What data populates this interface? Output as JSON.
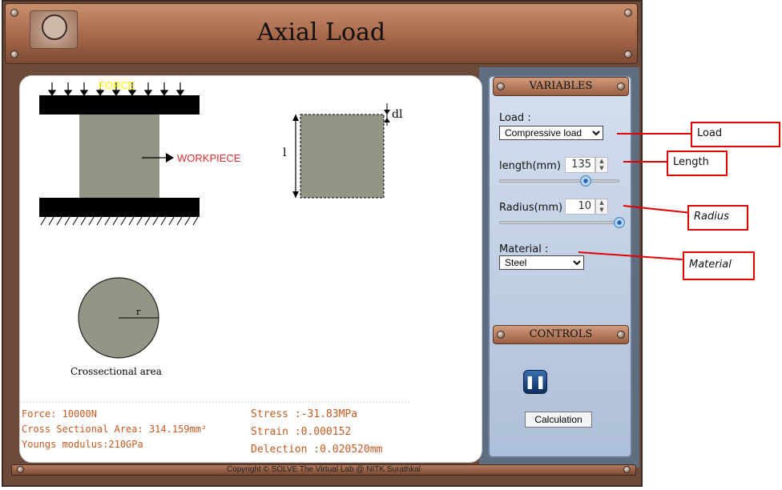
{
  "app": {
    "title": "Axial Load",
    "footer": "Copyright © SOLVE The Virtual Lab @ NITK Surathkal"
  },
  "diagram": {
    "force_label": "FORCE",
    "workpiece_label": "WORKPIECE",
    "length_symbol": "l",
    "delta_symbol": "dl",
    "radius_symbol": "r",
    "cross_section_label": "Crossectional area"
  },
  "results": {
    "force": "Force: 10000N",
    "area": "Cross Sectional Area: 314.159mm²",
    "youngs": "Youngs modulus:210GPa",
    "stress": "Stress :-31.83MPa",
    "strain": "Strain :0.000152",
    "deflection": "Delection :0.020520mm"
  },
  "variables": {
    "header": "VARIABLES",
    "load_label": "Load :",
    "load_selected": "Compressive load",
    "length_label": "length(mm)",
    "length_value": "135",
    "length_slider_fraction": 0.72,
    "radius_label": "Radius(mm)",
    "radius_value": "10",
    "radius_slider_fraction": 1.0,
    "material_label": "Material :",
    "material_selected": "Steel"
  },
  "controls": {
    "header": "CONTROLS",
    "calc_label": "Calculation"
  },
  "callouts": {
    "load": "Load",
    "length": "Length",
    "radius": "Radius",
    "material": "Material"
  },
  "colors": {
    "accent_red": "#e00000",
    "workpiece": "#939685",
    "result_text": "#c65a22",
    "force_text": "#ffff00"
  }
}
